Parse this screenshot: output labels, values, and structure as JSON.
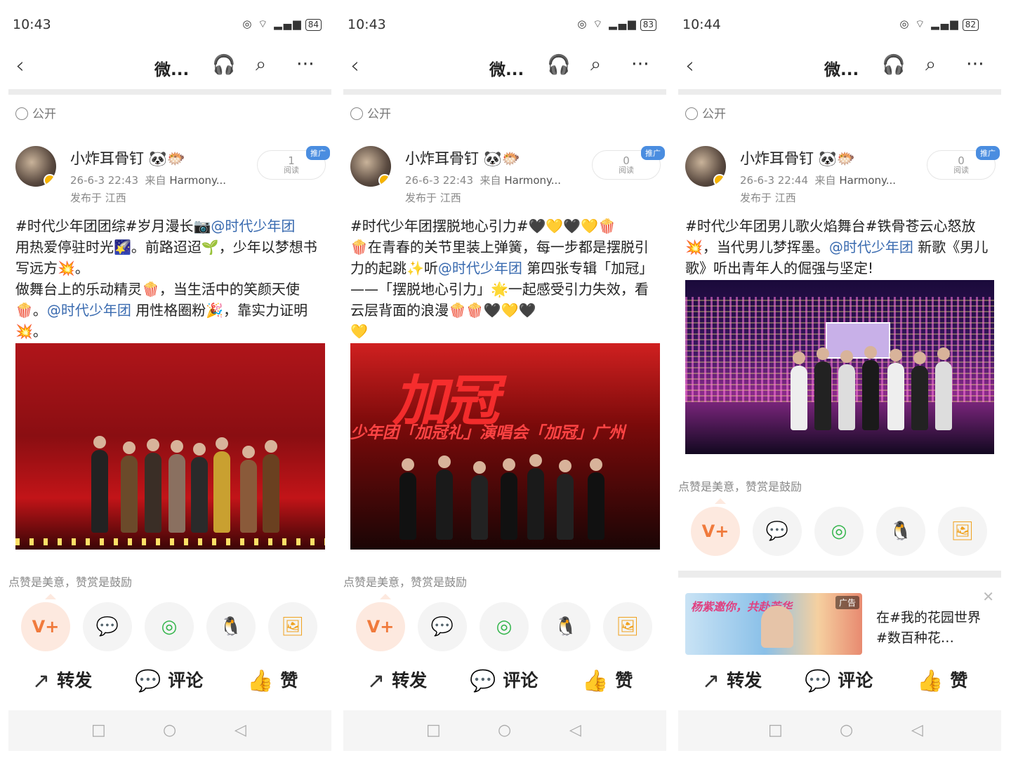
{
  "panels": [
    {
      "status": {
        "time": "10:43",
        "battery": "84"
      },
      "nav": {
        "title": "微..."
      },
      "visibility": "公开",
      "user": {
        "name": "小炸耳骨钉",
        "name_emoji": "🐼🐡",
        "date": "26-6-3 22:43",
        "source_prefix": "来自",
        "source": "Harmony...",
        "location": "发布于 江西"
      },
      "reads": {
        "count": "1",
        "label": "阅读",
        "promo_tag": "推广"
      },
      "post": {
        "p1": "#时代少年团团综#岁月漫长📷",
        "l1": "@时代少年团",
        "p2": "用热爱停驻时光🌠。前路迢迢🌱，少年以梦想书写远方💥。\n做舞台上的乐动精灵🍿，当生活中的笑颜天使🍿。",
        "l2": "@时代少年团",
        "p3": " 用性格圈粉🎉，靠实力证明💥。"
      },
      "encourage": "点赞是美意，赞赏是鼓励",
      "actions": {
        "repost": "转发",
        "comment": "评论",
        "like": "赞"
      }
    },
    {
      "status": {
        "time": "10:43",
        "battery": "83"
      },
      "nav": {
        "title": "微..."
      },
      "visibility": "公开",
      "user": {
        "name": "小炸耳骨钉",
        "name_emoji": "🐼🐡",
        "date": "26-6-3 22:43",
        "source_prefix": "来自",
        "source": "Harmony...",
        "location": "发布于 江西"
      },
      "reads": {
        "count": "0",
        "label": "阅读",
        "promo_tag": "推广"
      },
      "post": {
        "p1": "#时代少年团摆脱地心引力#🖤💛🖤💛🍿\n🍿在青春的关节里装上弹簧，每一步都是摆脱引力的起跳✨听",
        "l1": "@时代少年团",
        "p2": " 第四张专辑「加冠」——「摆脱地心引力」🌟一起感受引力失效，看云层背面的浪漫🍿🍿🖤💛🖤\n💛",
        "l2": "",
        "p3": ""
      },
      "image_text": {
        "big": "加冠",
        "banner": "少年团「加冠礼」演唱会「加冠」广州"
      },
      "encourage": "点赞是美意，赞赏是鼓励",
      "actions": {
        "repost": "转发",
        "comment": "评论",
        "like": "赞"
      }
    },
    {
      "status": {
        "time": "10:44",
        "battery": "82"
      },
      "nav": {
        "title": "微..."
      },
      "visibility": "公开",
      "user": {
        "name": "小炸耳骨钉",
        "name_emoji": "🐼🐡",
        "date": "26-6-3 22:44",
        "source_prefix": "来自",
        "source": "Harmony...",
        "location": "发布于 江西"
      },
      "reads": {
        "count": "0",
        "label": "阅读",
        "promo_tag": "推广"
      },
      "post": {
        "p1": "#时代少年团男儿歌火焰舞台#铁骨苍云心怒放💥，当代男儿梦挥墨。",
        "l1": "@时代少年团",
        "p2": " 新歌《男儿歌》听出青年人的倔强与坚定!",
        "l2": "",
        "p3": ""
      },
      "encourage": "点赞是美意，赞赏是鼓励",
      "ad": {
        "tag": "广告",
        "image_title": "杨紫邀你，共赴芳华",
        "text": "在#我的花园世界#数百种花…"
      },
      "actions": {
        "repost": "转发",
        "comment": "评论",
        "like": "赞"
      }
    }
  ],
  "icons": {
    "back": "‹",
    "listen": "🎧",
    "search": "⌕",
    "more": "···",
    "vplus": "V+",
    "wechat": "💬",
    "moments": "◎",
    "qq": "🐧",
    "save_image": "🖼",
    "repost": "↗",
    "comment": "💬",
    "like": "👍",
    "nav_square": "□",
    "nav_circle": "○",
    "nav_back": "◁",
    "close": "✕"
  },
  "colors": {
    "link": "#3a6bb0",
    "accent": "#f07a3c"
  }
}
